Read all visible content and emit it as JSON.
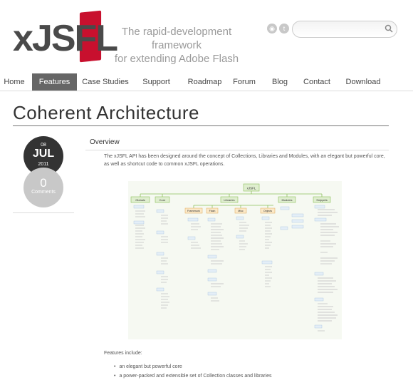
{
  "brand": {
    "name": "xJSFL",
    "tagline_line1": "The rapid-development framework",
    "tagline_line2": "for extending Adobe Flash",
    "accent_color": "#c8102e"
  },
  "social": [
    {
      "icon": "rss-icon"
    },
    {
      "icon": "twitter-icon"
    }
  ],
  "search": {
    "placeholder": "",
    "value": "",
    "icon": "search-icon"
  },
  "nav": {
    "items": [
      {
        "label": "Home"
      },
      {
        "label": "Features",
        "active": true
      },
      {
        "label": "Case Studies"
      },
      {
        "label": "Support"
      },
      {
        "label": "Roadmap"
      },
      {
        "label": "Forum"
      },
      {
        "label": "Blog"
      },
      {
        "label": "Contact"
      },
      {
        "label": "Download"
      }
    ]
  },
  "page": {
    "title": "Coherent Architecture"
  },
  "post_meta": {
    "day": "08",
    "month": "JUL",
    "year": "2011",
    "comment_count": "0",
    "comment_label": "Comments"
  },
  "article": {
    "section_title": "Overview",
    "intro": "The xJSFL API has been designed around the concept of Collections, Libraries and Modules, with an elegant but powerful core, as well as shortcut code to common xJSFL operations.",
    "features_label": "Features include:",
    "features": [
      "an elegant but powerful core",
      "a power-packed and extensible set of Collection classes and libraries"
    ]
  },
  "diagram": {
    "root": "xJSFL",
    "branches": [
      "Globals",
      "Core",
      "Libraries",
      "Modules",
      "Snippets"
    ],
    "sub_branches": [
      "Framework",
      "Flash",
      "Misc",
      "Objects"
    ]
  }
}
